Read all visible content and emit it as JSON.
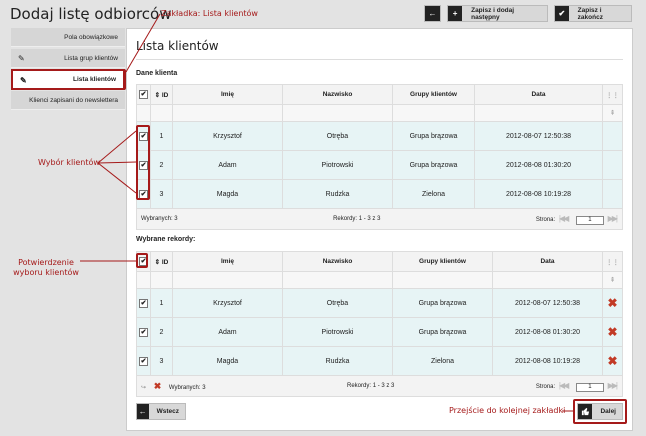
{
  "page": {
    "title": "Dodaj listę odbiorców"
  },
  "top": {
    "back_icon": "←",
    "save_next_label": "Zapisz i dodaj następny",
    "save_close_label": "Zapisz i zakończ",
    "plus_icon": "+",
    "check_icon": "✔"
  },
  "sidebar": {
    "items": [
      {
        "label": "Pola obowiązkowe",
        "icon": ""
      },
      {
        "label": "Lista grup klientów",
        "icon": "✎"
      },
      {
        "label": "Lista klientów",
        "icon": "✎"
      },
      {
        "label": "Klienci zapisani do newslettera",
        "icon": ""
      }
    ]
  },
  "main": {
    "title": "Lista klientów"
  },
  "grid1": {
    "label": "Dane klienta",
    "headers": {
      "sort": "⇕ ID",
      "first": "Imię",
      "last": "Nazwisko",
      "group": "Grupy klientów",
      "date": "Data"
    },
    "rows": [
      {
        "id": "1",
        "first": "Krzysztof",
        "last": "Otręba",
        "group": "Grupa brązowa",
        "date": "2012-08-07 12:50:38"
      },
      {
        "id": "2",
        "first": "Adam",
        "last": "Piotrowski",
        "group": "Grupa brązowa",
        "date": "2012-08-08 01:30:20"
      },
      {
        "id": "3",
        "first": "Magda",
        "last": "Rudzka",
        "group": "Zielona",
        "date": "2012-08-08 10:19:28"
      }
    ],
    "footer": {
      "selected": "Wybranych: 3",
      "records": "Rekordy: 1 - 3 z 3",
      "page_label": "Strona:",
      "page": "1"
    }
  },
  "grid2": {
    "label": "Wybrane rekordy:",
    "headers": {
      "sort": "⇕ ID",
      "first": "Imię",
      "last": "Nazwisko",
      "group": "Grupy klientów",
      "date": "Data"
    },
    "rows": [
      {
        "id": "1",
        "first": "Krzysztof",
        "last": "Otręba",
        "group": "Grupa brązowa",
        "date": "2012-08-07 12:50:38"
      },
      {
        "id": "2",
        "first": "Adam",
        "last": "Piotrowski",
        "group": "Grupa brązowa",
        "date": "2012-08-08 01:30:20"
      },
      {
        "id": "3",
        "first": "Magda",
        "last": "Rudzka",
        "group": "Zielona",
        "date": "2012-08-08 10:19:28"
      }
    ],
    "footer": {
      "selected": "Wybranych: 3",
      "records": "Rekordy: 1 - 3 z 3",
      "page_label": "Strona:",
      "page": "1"
    }
  },
  "bottom": {
    "back_label": "Wstecz",
    "next_label": "Dalej"
  },
  "annotations": {
    "tab": "Zakładka: Lista klientów",
    "select": "Wybór klientów",
    "confirm": "Potwierdzenie wyboru klientów",
    "next": "Przejście do kolejnej zakładki"
  },
  "colors": {
    "annotation": "#a51a1a",
    "row": "#e7f4f5",
    "delete": "#c23a26"
  }
}
